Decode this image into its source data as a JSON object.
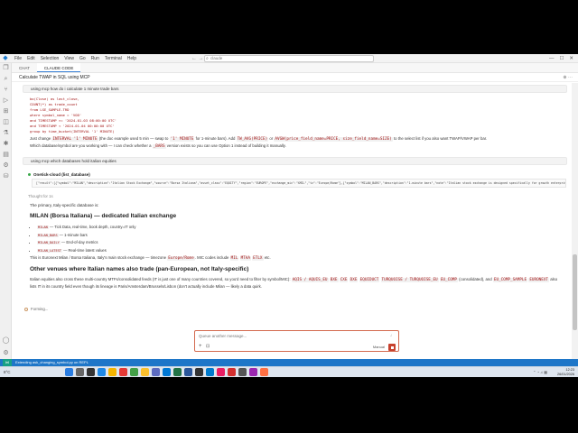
{
  "titlebar": {
    "menus": [
      "File",
      "Edit",
      "Selection",
      "View",
      "Go",
      "Run",
      "Terminal",
      "Help"
    ],
    "search_text": "claude"
  },
  "tabs": [
    "CHAT",
    "CLAUDE CODE"
  ],
  "conversation_title": "Calculate TWAP in SQL using MCP",
  "messages": {
    "user1": "using mcp how do i calculate 1 minute trade bars",
    "code_lines": [
      "bo(Close) as last_close,",
      "COUNT(*) as trade_count",
      "from LSE_SAMPLE.TRD",
      "where symbol_name = 'VOD'",
      "and TIMESTAMP >= '2024-01-03 08:00:00 UTC'",
      "and TIMESTAMP < '2024-01-04 00:00:00 UTC'",
      "group by time_bucket(INTERVAL '1' MINUTE)"
    ],
    "para1a_pre": "Just change ",
    "para1a_code1": "INTERVAL '1' MINUTE",
    "para1a_mid": " (the doc example used 5 min — swap to ",
    "para1a_code2": "'1' MINUTE",
    "para1a_mid2": " for 1-minute bars). Add ",
    "para1a_code3": "TW_AVG(PRICE)",
    "para1a_mid3": " or ",
    "para1a_code4": "AVGW(price_field_name=PRICE, size_field_name=SIZE)",
    "para1a_post": " to the select list if you also want TWAP/VWAP per bar.",
    "para1b_pre": "Which database/symbol are you working with — I can check whether a ",
    "para1b_code": "_BARS",
    "para1b_post": " version exists so you can use Option 1 instead of building it manually.",
    "user2": "using mcp which databases hold italian equities",
    "tool_label": "Onetick-cloud (list_database)",
    "tool_json": "[\"result\":[{\"symbol\":\"MILAN\",\"description\":\"Italian Stock Exchange\",\"source\":\"Borsa Italiana\",\"asset_class\":\"EQUITY\",\"region\":\"EUROPE\",\"exchange_mic\":\"XMIL\",\"tz\":\"Europe/Rome\"},{\"symbol\":\"MILAN_BARS\",\"description\":\"1-minute bars\",\"note\":\"Italian stock exchange is designed specifically for growth enterprises\",\"data_types\":[\"TRD\",\"QTE\",\"NBBO\"]}]}",
    "thought": "Thought for 1s",
    "primary_line": "The primary, Italy-specific database is:",
    "heading1": "MILAN (Borsa Italiana) — dedicated Italian exchange",
    "bullets": [
      {
        "code": "MILAN",
        "text": " — Tick Data, real-time, book depth, country=IT only"
      },
      {
        "code": "MILAN_BARS",
        "text": " — 1-minute bars"
      },
      {
        "code": "MILAN_DAILY",
        "text": " — End-of-day metrics"
      },
      {
        "code": "MILAN_LATEST",
        "text": " — Real-time latest values"
      }
    ],
    "venue_pre": "This is Euronext Milan / Borsa Italiana, Italy's main stock exchange — timezone ",
    "venue_code1": "Europe/Rome",
    "venue_mid": ". MIC codes include ",
    "venue_code2": "MIL",
    "venue_code3": "MTAA",
    "venue_code4": "ETLX",
    "venue_post": " etc.",
    "heading2": "Other venues where Italian names also trade (pan-European, not Italy-specific)",
    "other_pre": "Italian equities also cross these multi-country MTFs/consolidated feeds (IT is just one of many countries covered, so you'd need to filter by symbol/MIC): ",
    "other_codes": [
      "AQIS / AQUIS_EU",
      "BXE",
      "CXE",
      "DXE",
      "EQUIDUCT",
      "TURQUOISE / TURQUOISE_EU",
      "EU_COMP"
    ],
    "other_mid": " (consolidated), and ",
    "other_code_last": "EU_COMP_SAMPLE",
    "other_code_last2": "EURONEXT",
    "other_post": " also lists IT in its country field even though its lineage is Paris/Amsterdam/Brussels/Lisbon (don't actually include Milan — likely a data quirk.",
    "forming": "Forming..."
  },
  "input": {
    "placeholder": "Queue another message...",
    "mode": "Manual"
  },
  "statusbar": {
    "remote": "",
    "text": "Extending ask_changing_symbol.py on REPL"
  },
  "taskbar": {
    "weather": "8°C",
    "time": "12:23",
    "date": "26/01/2026"
  },
  "colors": {
    "accent": "#1e76c8",
    "input_border": "#d36a4f",
    "stop_button": "#c7412e"
  }
}
